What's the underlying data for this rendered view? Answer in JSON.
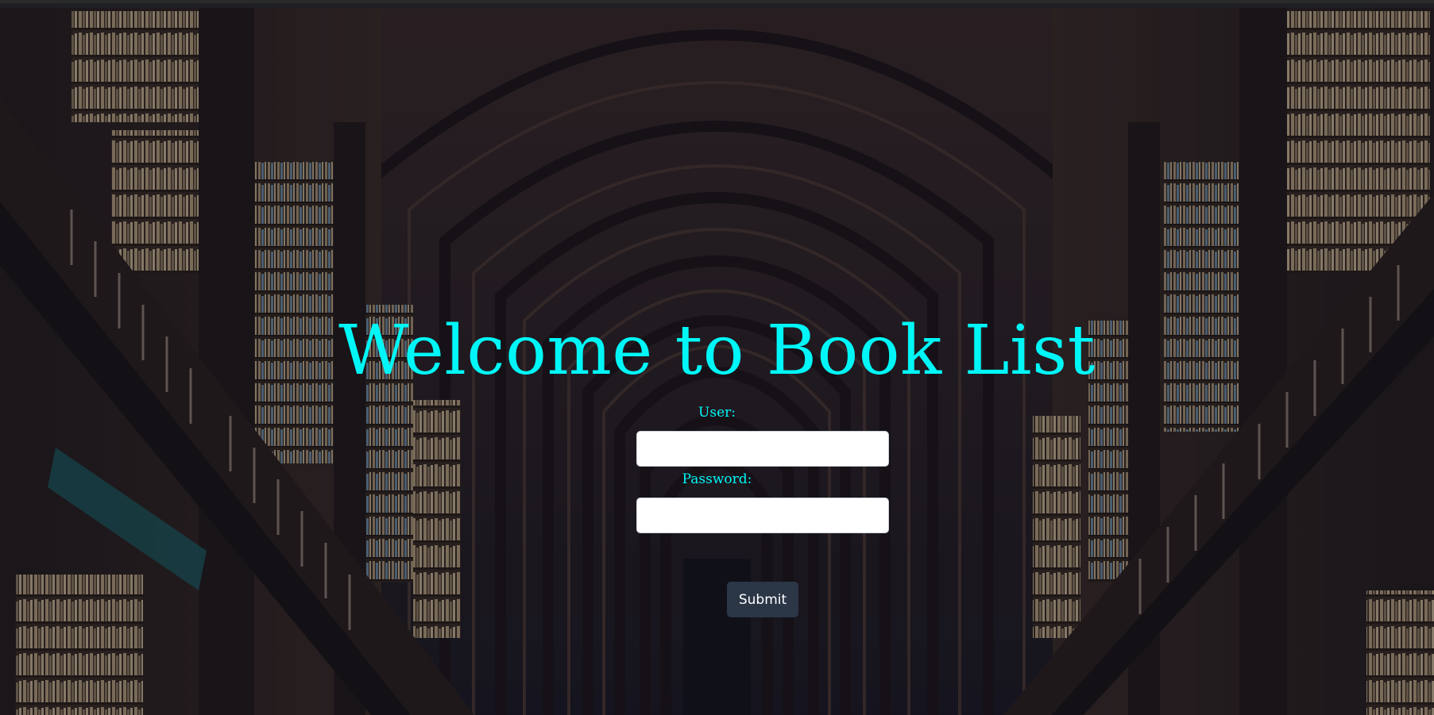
{
  "page": {
    "title": "Welcome to Book List"
  },
  "login_form": {
    "user_label": "User:",
    "user_value": "",
    "password_label": "Password:",
    "password_value": "",
    "submit_label": "Submit"
  },
  "colors": {
    "title_text": "#00f7f7",
    "label_text": "#00f7f7",
    "submit_background": "#2b3646",
    "submit_text": "#ffffff",
    "input_background": "#ffffff"
  },
  "background": {
    "image": "library-hall-photo"
  }
}
